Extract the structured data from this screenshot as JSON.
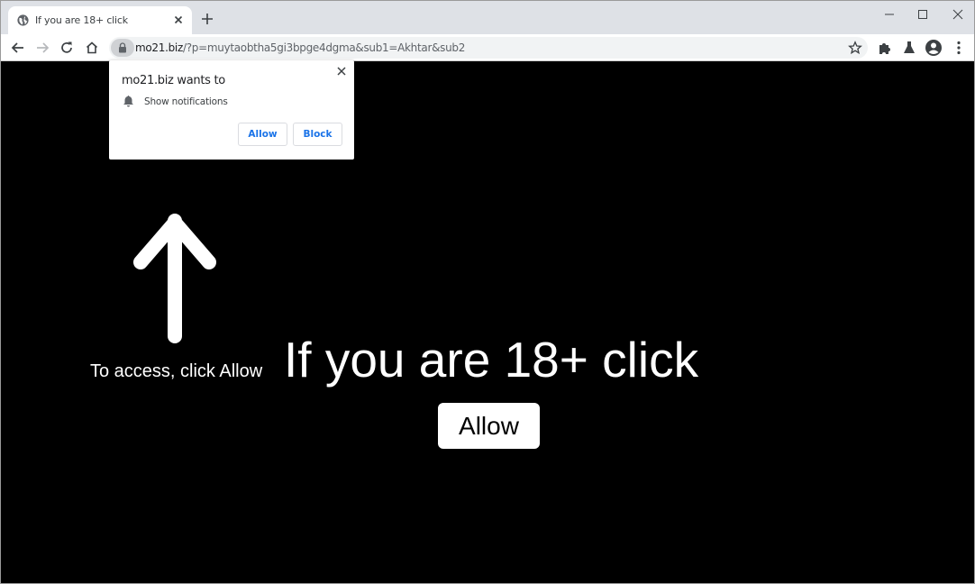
{
  "browser": {
    "tab": {
      "title": "If you are 18+ click",
      "favicon": "globe-icon"
    },
    "new_tab_label": "+",
    "window_controls": [
      "minimize-icon",
      "maximize-icon",
      "close-icon"
    ],
    "nav": {
      "back": "back-arrow-icon",
      "forward": "forward-arrow-icon",
      "reload": "reload-icon",
      "home": "home-icon"
    },
    "address": {
      "host": "mo21.biz",
      "path": "/?p=muytaobtha5gi3bpge4dgma&sub1=Akhtar&sub2",
      "security_icon": "lock-icon"
    },
    "toolbar_icons": [
      "bookmark-star-icon",
      "extensions-puzzle-icon",
      "labs-flask-icon",
      "profile-avatar-icon",
      "menu-kebab-icon"
    ]
  },
  "permission_popup": {
    "title": "mo21.biz wants to",
    "permission": "Show notifications",
    "permission_icon": "bell-icon",
    "allow_label": "Allow",
    "block_label": "Block",
    "accent_color": "#1a73e8"
  },
  "page": {
    "instruction": "To access, click Allow",
    "headline": "If you are 18+ click",
    "button_label": "Allow",
    "background_color": "#000000",
    "text_color": "#ffffff"
  }
}
